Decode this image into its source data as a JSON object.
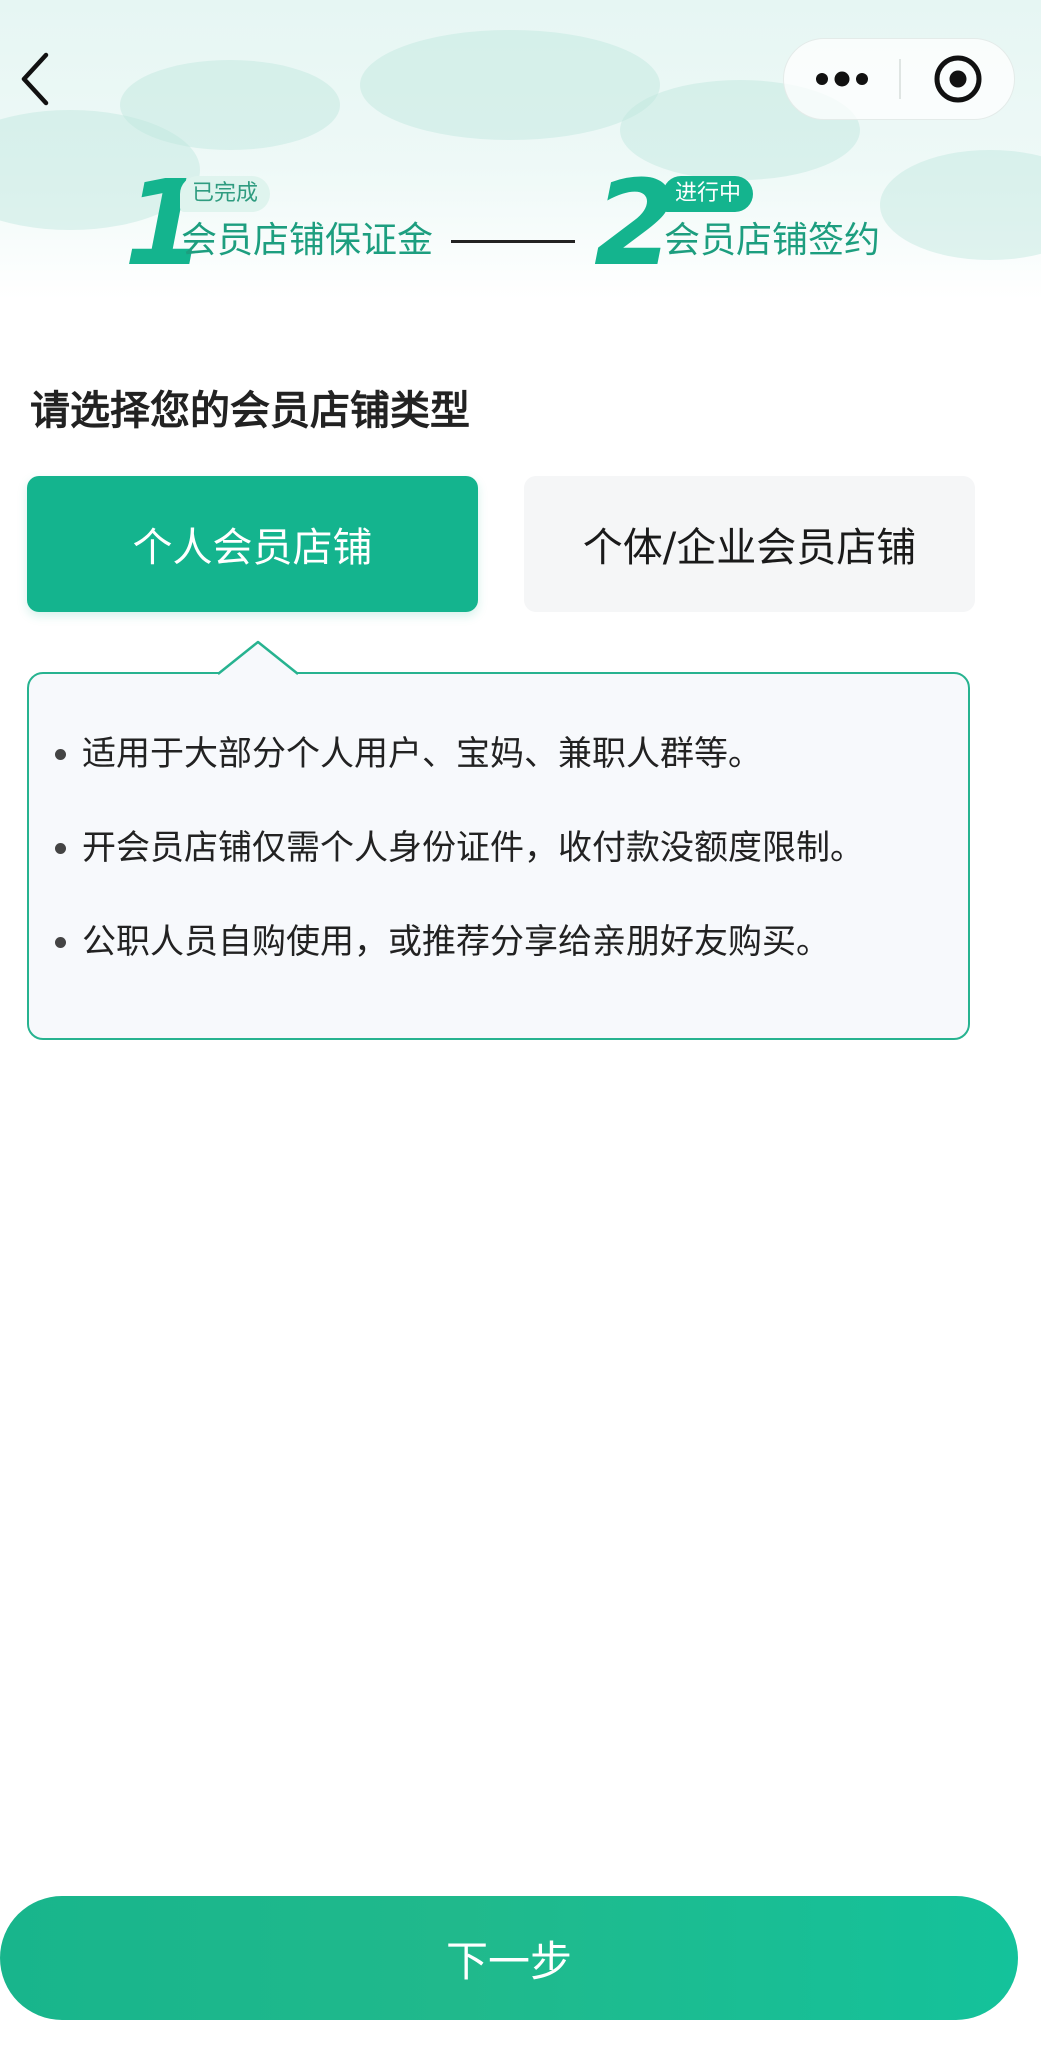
{
  "nav": {
    "back_icon": "chevron-left-icon",
    "more_icon": "more-dots-icon",
    "close_icon": "target-close-icon"
  },
  "steps": [
    {
      "number": "1",
      "badge": "已完成",
      "label": "会员店铺保证金",
      "status": "done"
    },
    {
      "number": "2",
      "badge": "进行中",
      "label": "会员店铺签约",
      "status": "in-progress"
    }
  ],
  "main": {
    "title": "请选择您的会员店铺类型",
    "options": [
      {
        "label": "个人会员店铺",
        "selected": true
      },
      {
        "label": "个体/企业会员店铺",
        "selected": false
      }
    ],
    "description": [
      "适用于大部分个人用户、宝妈、兼职人群等。",
      "开会员店铺仅需个人身份证件，收付款没额度限制。",
      "公职人员自购使用，或推荐分享给亲朋好友购买。"
    ]
  },
  "footer": {
    "next_label": "下一步"
  },
  "colors": {
    "accent": "#14b48e",
    "card_border": "#27b390",
    "card_bg": "#f7f9fc",
    "text_dark": "#222222"
  }
}
